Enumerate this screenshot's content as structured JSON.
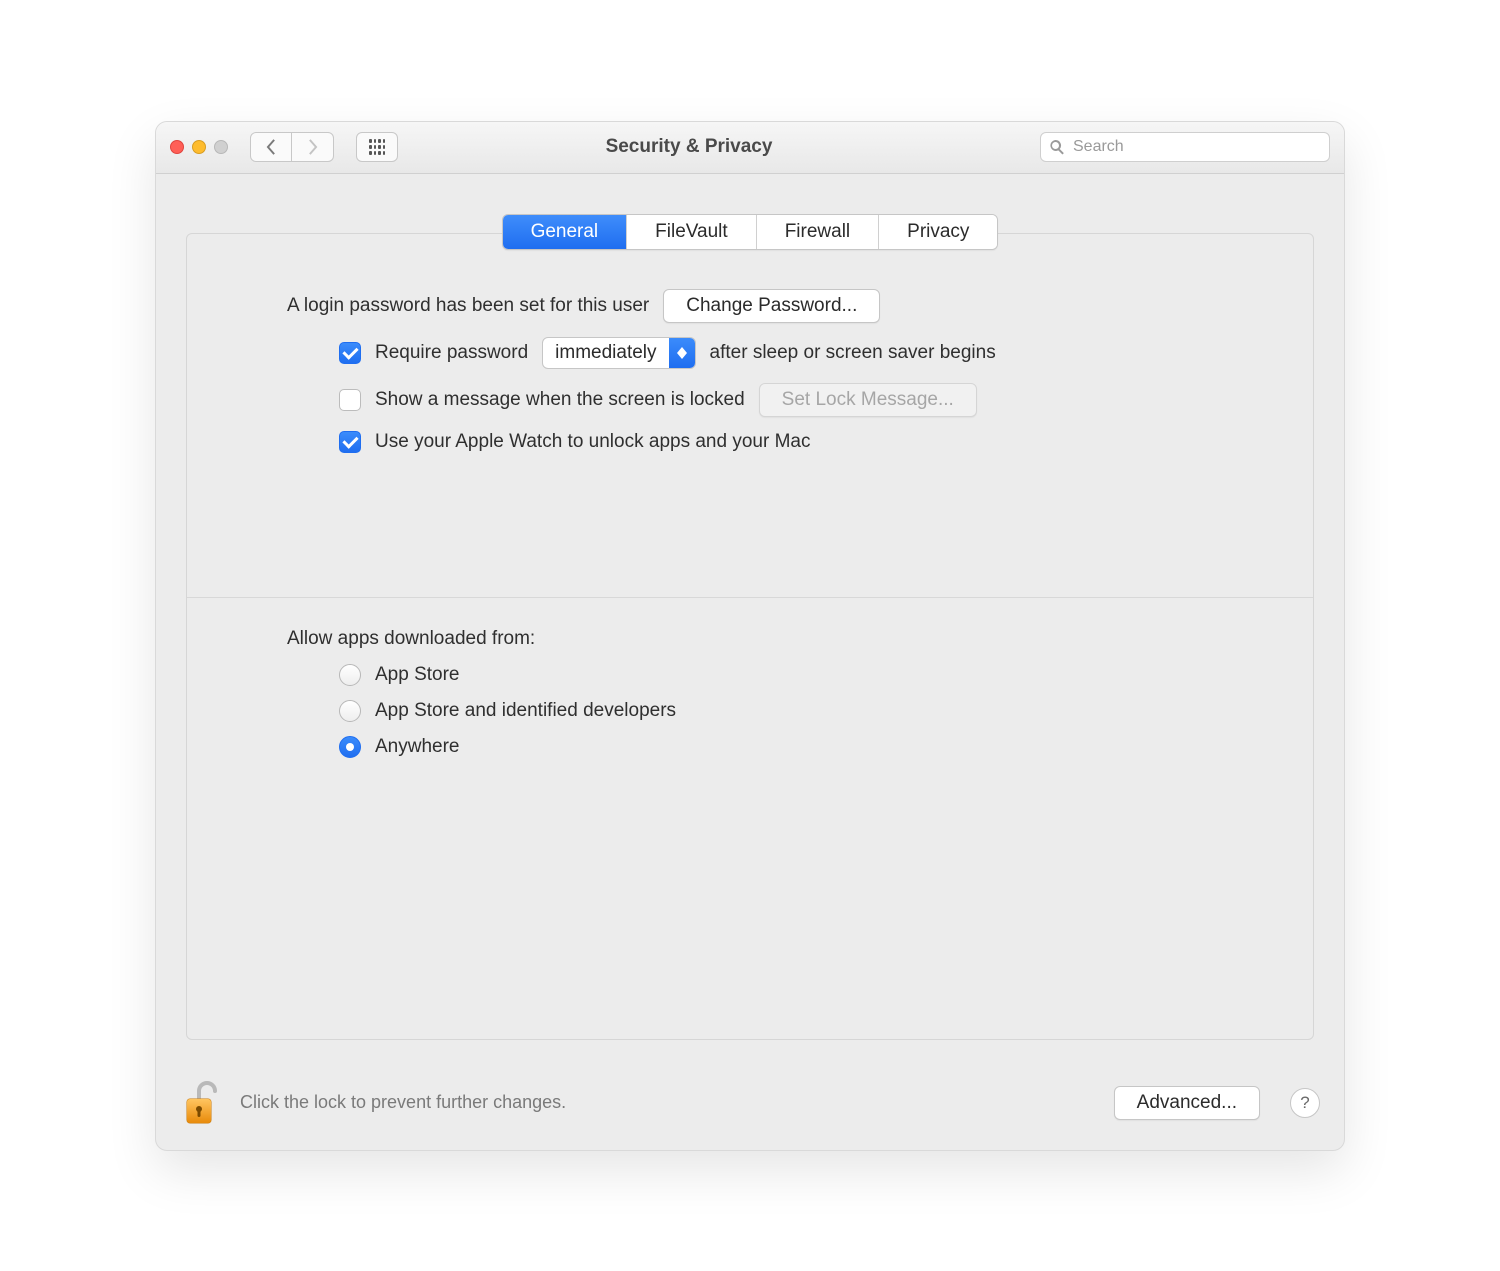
{
  "window_title": "Security & Privacy",
  "search": {
    "placeholder": "Search"
  },
  "tabs": [
    {
      "label": "General",
      "active": true
    },
    {
      "label": "FileVault",
      "active": false
    },
    {
      "label": "Firewall",
      "active": false
    },
    {
      "label": "Privacy",
      "active": false
    }
  ],
  "login_text": "A login password has been set for this user",
  "change_password_label": "Change Password...",
  "require_password": {
    "checked": true,
    "label_before": "Require password",
    "select_value": "immediately",
    "label_after": "after sleep or screen saver begins"
  },
  "show_message": {
    "checked": false,
    "label": "Show a message when the screen is locked",
    "button_label": "Set Lock Message...",
    "button_enabled": false
  },
  "apple_watch": {
    "checked": true,
    "label": "Use your Apple Watch to unlock apps and your Mac"
  },
  "allow_apps_heading": "Allow apps downloaded from:",
  "allow_apps_options": [
    {
      "label": "App Store",
      "selected": false
    },
    {
      "label": "App Store and identified developers",
      "selected": false
    },
    {
      "label": "Anywhere",
      "selected": true
    }
  ],
  "lock_text": "Click the lock to prevent further changes.",
  "advanced_label": "Advanced...",
  "help_label": "?"
}
